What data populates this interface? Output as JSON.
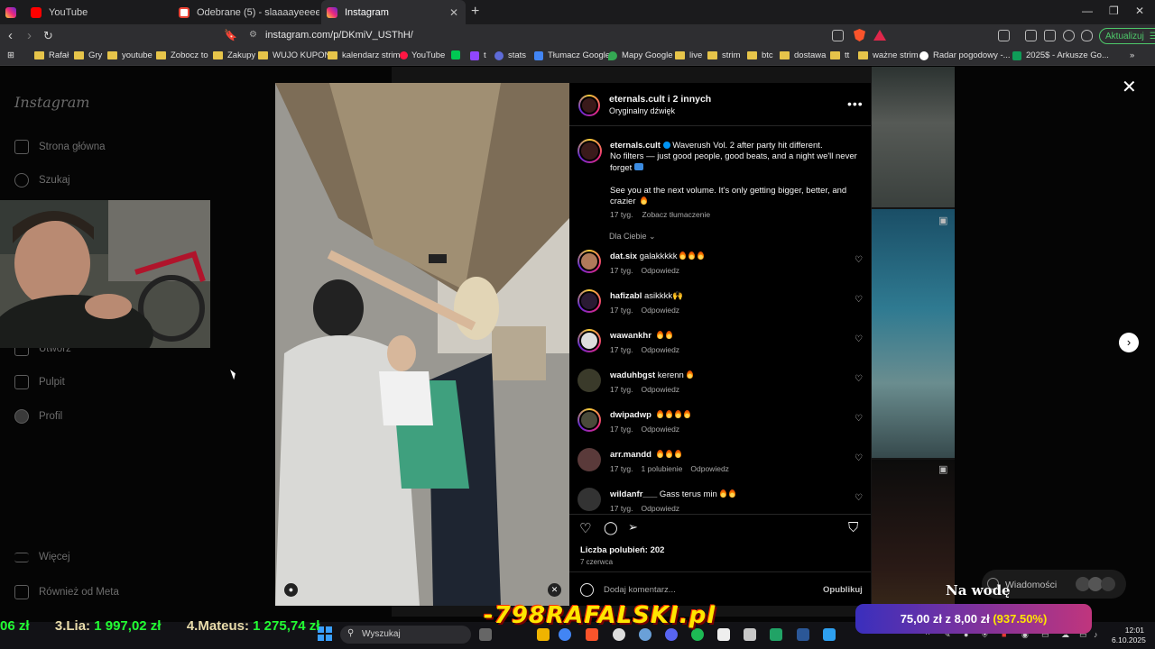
{
  "browser": {
    "tabs": [
      {
        "label": "YouTube",
        "icon": "youtube-icon"
      },
      {
        "label": "Odebrane (5) - slaaaayeeeer@gmail.c",
        "icon": "gmail-icon"
      },
      {
        "label": "Instagram",
        "icon": "instagram-icon",
        "active": true
      }
    ],
    "url": "instagram.com/p/DKmiV_USThH/",
    "update_label": "Aktualizuj",
    "bookmarks": [
      "Rafał",
      "Gry",
      "youtube",
      "Zobocz to",
      "Zakupy",
      "WUJO KUPON",
      "kalendarz strim",
      "YouTube",
      "t",
      "stats",
      "Tłumacz Google",
      "Mapy Google",
      "live",
      "strim",
      "btc",
      "dostawa",
      "tt",
      "ważne strim",
      "Radar pogodowy -...",
      "2025$ - Arkusze Go..."
    ]
  },
  "sidebar": {
    "logo": "Instagram",
    "items": [
      {
        "label": "Strona główna",
        "icon": "home-icon"
      },
      {
        "label": "Szukaj",
        "icon": "search-icon"
      },
      {
        "label": "Utwórz",
        "icon": "create-icon"
      },
      {
        "label": "Pulpit",
        "icon": "dashboard-icon"
      },
      {
        "label": "Profil",
        "icon": "profile-icon"
      },
      {
        "label": "Więcej",
        "icon": "menu-icon"
      },
      {
        "label": "Również od Meta",
        "icon": "meta-icon"
      }
    ]
  },
  "post": {
    "header_name": "eternals.cult i 2 innych",
    "header_sub": "Oryginalny dźwięk",
    "caption_user": "eternals.cult",
    "caption_line1": "Waverush Vol. 2 after party hit different.",
    "caption_line2": "No filters — just good people, good beats, and a night we'll never forget",
    "caption_line3": "See you at the next volume. It's only getting bigger, better, and crazier",
    "caption_time": "17 tyg.",
    "translate": "Zobacz tłumaczenie",
    "for_you": "Dla Ciebie",
    "comments": [
      {
        "user": "dat.six",
        "text": "galakkkkk",
        "fires": 3,
        "time": "17 tyg.",
        "likes": "",
        "reply": "Odpowiedz"
      },
      {
        "user": "hafizabl",
        "text": "asikkkk🙌",
        "fires": 0,
        "time": "17 tyg.",
        "likes": "",
        "reply": "Odpowiedz"
      },
      {
        "user": "wawankhr",
        "text": "",
        "fires": 2,
        "time": "17 tyg.",
        "likes": "",
        "reply": "Odpowiedz"
      },
      {
        "user": "waduhbgst",
        "text": "kerenn",
        "fires": 1,
        "time": "17 tyg.",
        "likes": "",
        "reply": "Odpowiedz"
      },
      {
        "user": "dwipadwp",
        "text": "",
        "fires": 4,
        "time": "17 tyg.",
        "likes": "",
        "reply": "Odpowiedz"
      },
      {
        "user": "arr.mandd",
        "text": "",
        "fires": 3,
        "time": "17 tyg.",
        "likes": "1 polubienie",
        "reply": "Odpowiedz"
      },
      {
        "user": "wildanfr___",
        "text": "Gass terus min",
        "fires": 2,
        "time": "17 tyg.",
        "likes": "",
        "reply": "Odpowiedz"
      }
    ],
    "likes": "Liczba polubień: 202",
    "date": "7 czerwca",
    "comment_placeholder": "Dodaj komentarz...",
    "post_button": "Opublikuj"
  },
  "messages_label": "Wiadomości",
  "overlay": {
    "nawode": "Na wodę",
    "ticker_a": "06 zł",
    "ticker_b": "3.Lia:",
    "ticker_b_val": "1 997,02 zł",
    "ticker_c": "4.Mateus:",
    "ticker_c_val": "1 275,74 zł",
    "brand": "-798RAFALSKI.pl",
    "donation_main": "75,00 zł z 8,00 zł",
    "donation_pct": "(937.50%)"
  },
  "taskbar": {
    "search_placeholder": "Wyszukaj",
    "time": "12:01",
    "date": "6.10.2025"
  },
  "colors": {
    "accent": "#0095f6",
    "donation_from": "#3a2fbd",
    "donation_to": "#c0357d"
  }
}
